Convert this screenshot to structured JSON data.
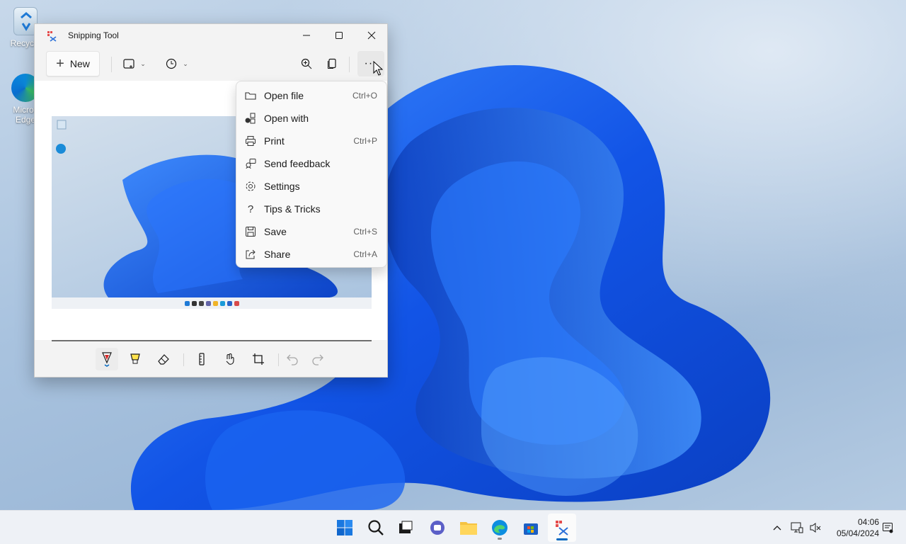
{
  "desktop": {
    "icons": [
      {
        "label": "Recycle",
        "name": "recycle-bin-icon"
      },
      {
        "label": "Micros\nEdge",
        "name": "edge-icon"
      }
    ]
  },
  "window": {
    "title": "Snipping Tool",
    "toolbar": {
      "new_label": "New",
      "snip_mode_icon": "rectangle-snip-icon",
      "delay_icon": "clock-icon",
      "zoom_icon": "zoom-in-icon",
      "copy_icon": "copy-icon",
      "more_label": "···"
    },
    "bottom_tools": [
      "ballpoint-pen-icon",
      "highlighter-icon",
      "eraser-icon",
      "ruler-icon",
      "touch-writing-icon",
      "crop-icon",
      "undo-icon",
      "redo-icon"
    ]
  },
  "menu": {
    "items": [
      {
        "label": "Open file",
        "shortcut": "Ctrl+O",
        "icon": "folder-icon"
      },
      {
        "label": "Open with",
        "shortcut": "",
        "icon": "open-with-icon"
      },
      {
        "label": "Print",
        "shortcut": "Ctrl+P",
        "icon": "printer-icon"
      },
      {
        "label": "Send feedback",
        "shortcut": "",
        "icon": "feedback-icon"
      },
      {
        "label": "Settings",
        "shortcut": "",
        "icon": "gear-icon"
      },
      {
        "label": "Tips & Tricks",
        "shortcut": "",
        "icon": "question-icon"
      },
      {
        "label": "Save",
        "shortcut": "Ctrl+S",
        "icon": "save-icon"
      },
      {
        "label": "Share",
        "shortcut": "Ctrl+A",
        "icon": "share-icon"
      }
    ]
  },
  "taskbar": {
    "apps": [
      "start-icon",
      "search-icon",
      "task-view-icon",
      "teams-chat-icon",
      "file-explorer-icon",
      "edge-icon",
      "store-icon",
      "snipping-tool-icon"
    ],
    "clock": {
      "time": "04:06",
      "date": "05/04/2024"
    }
  },
  "colors": {
    "accent": "#0067c0",
    "wallpaper_blue": "#1a5ee0"
  }
}
